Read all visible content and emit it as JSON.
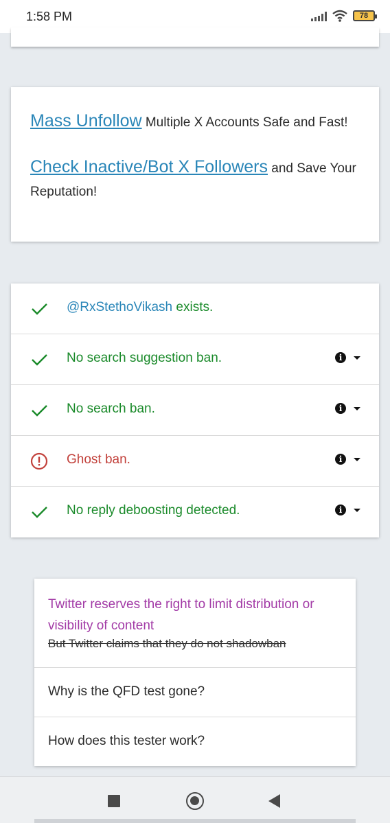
{
  "status_bar": {
    "time": "1:58 PM",
    "battery": "78",
    "icons": [
      "signal-icon",
      "wifi-icon",
      "battery-icon"
    ]
  },
  "promo": {
    "line1_link": "Mass Unfollow",
    "line1_text": " Multiple X Accounts Safe and Fast!",
    "line2_link": "Check Inactive/Bot X Followers",
    "line2_text": " and Save Your Reputation!"
  },
  "results": {
    "handle": "@RxStethoVikash",
    "exists_text": " exists.",
    "rows": [
      {
        "text": "No search suggestion ban.",
        "status": "ok"
      },
      {
        "text": "No search ban.",
        "status": "ok"
      },
      {
        "text": "Ghost ban.",
        "status": "warning"
      },
      {
        "text": "No reply deboosting detected.",
        "status": "ok"
      }
    ]
  },
  "faq": {
    "notice": "Twitter reserves the right to limit distribution or visibility of content",
    "claim": "But Twitter claims that they do not shadowban",
    "items": [
      "Why is the QFD test gone?",
      "How does this tester work?"
    ]
  },
  "colors": {
    "link": "#2a86b8",
    "ok": "#1a8a2a",
    "warning": "#c2413b",
    "notice": "#a23aa6"
  },
  "navbar": {
    "icons": [
      "recents-square-icon",
      "home-circle-icon",
      "back-triangle-icon"
    ]
  }
}
